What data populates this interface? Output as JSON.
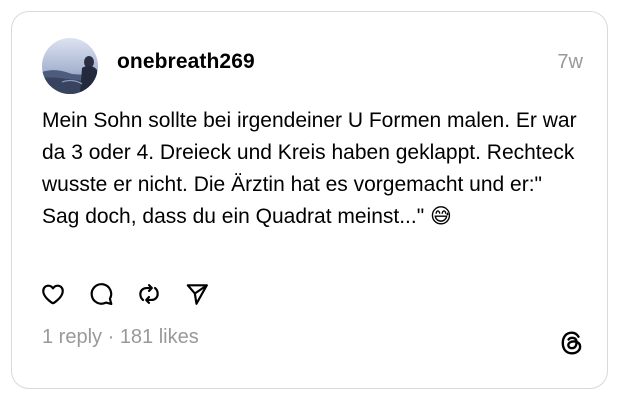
{
  "post": {
    "username": "onebreath269",
    "timestamp": "7w",
    "text": "Mein Sohn sollte bei irgendeiner U Formen malen. Er war da 3 oder 4. Dreieck und Kreis haben geklappt. Rechteck wusste er nicht. Die Ärztin hat es vorgemacht und er:\" Sag doch, dass du ein Quadrat meinst...\" 😅",
    "replies": "1 reply",
    "separator": " · ",
    "likes": "181 likes"
  },
  "icons": {
    "like": "heart-icon",
    "reply": "comment-icon",
    "repost": "repost-icon",
    "share": "share-icon",
    "brand": "threads-logo-icon"
  },
  "colors": {
    "text": "#000000",
    "muted": "#999999",
    "border": "#d9d9d9"
  }
}
